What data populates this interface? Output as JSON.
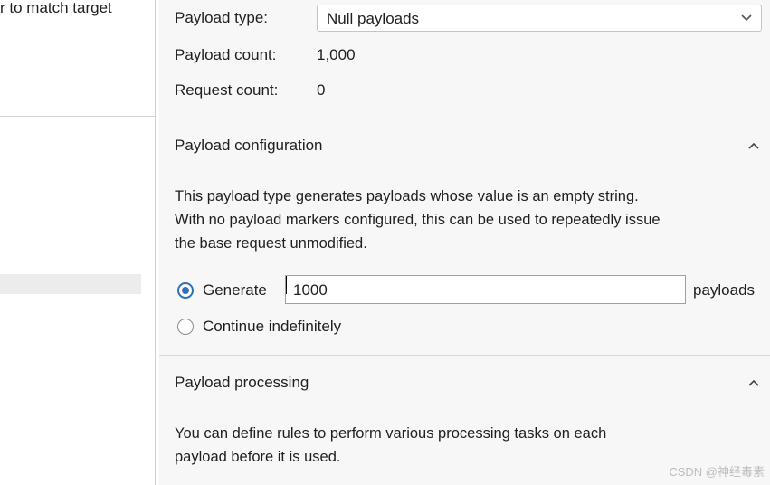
{
  "left_panel": {
    "partial_text": "r to match target"
  },
  "payload_sets": {
    "type_label": "Payload type:",
    "type_value": "Null payloads",
    "count_label": "Payload count:",
    "count_value": "1,000",
    "request_label": "Request count:",
    "request_value": "0"
  },
  "config_section": {
    "title": "Payload configuration",
    "description_line1": "This payload type generates payloads whose value is an empty string.",
    "description_line2": "With no payload markers configured, this can be used to repeatedly issue",
    "description_line3": "the base request unmodified.",
    "generate_label": "Generate",
    "generate_value": "1000",
    "payloads_suffix": "payloads",
    "continue_label": "Continue indefinitely",
    "generate_selected": true
  },
  "processing_section": {
    "title": "Payload processing",
    "description_line1": "You can define rules to perform various processing tasks on each",
    "description_line2": "payload before it is used."
  },
  "watermark": "CSDN @神经毒素"
}
